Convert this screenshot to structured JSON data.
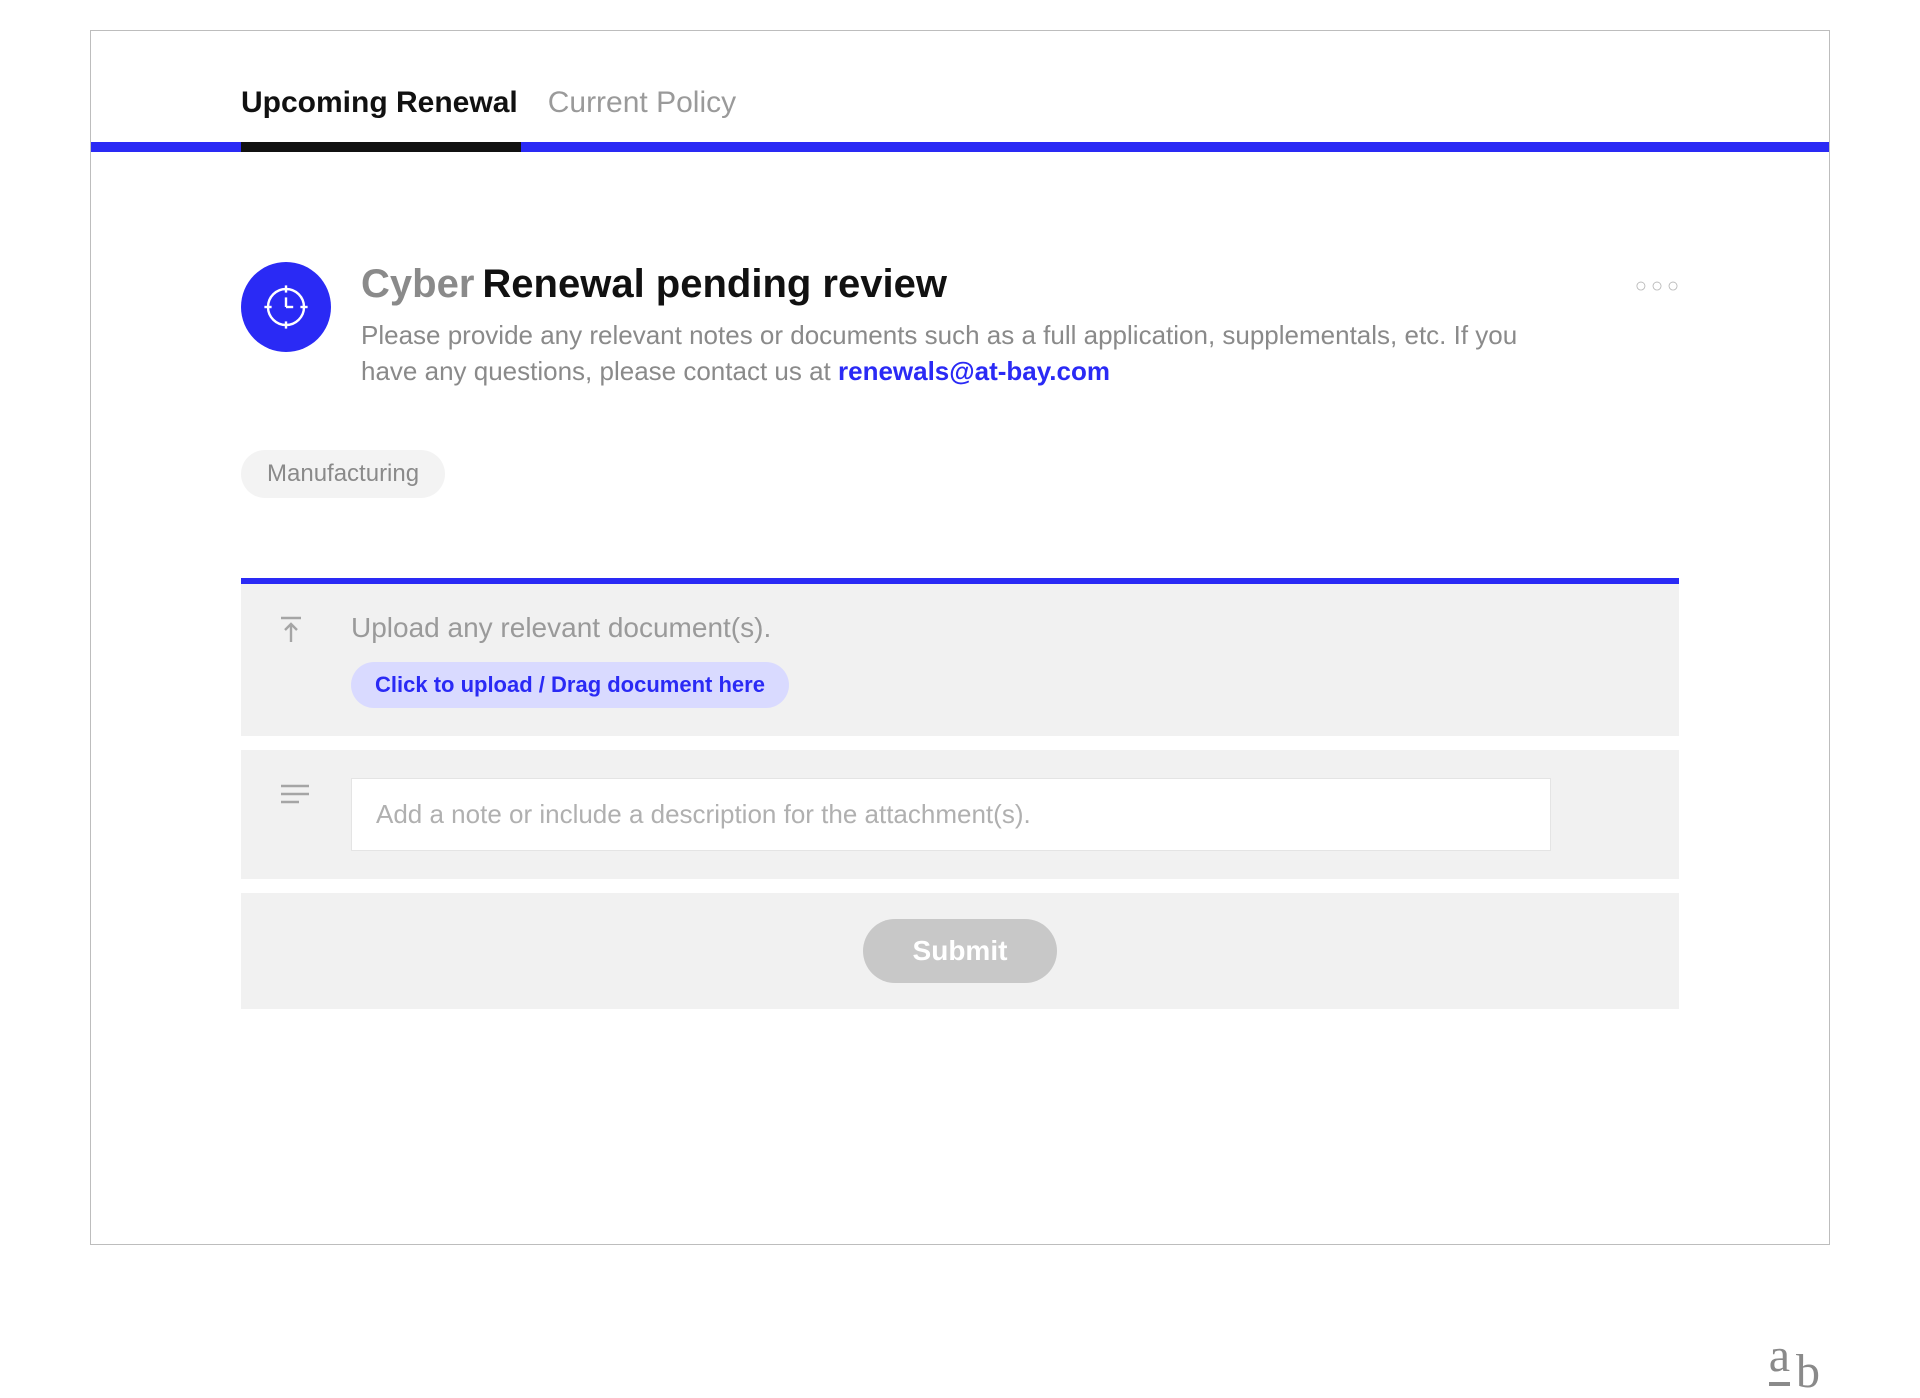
{
  "tabs": {
    "upcoming": "Upcoming Renewal",
    "current": "Current Policy"
  },
  "header": {
    "title_prefix": "Cyber",
    "title_rest": "Renewal pending review",
    "description_pre": "Please provide any relevant notes or documents such as a full application, supplementals, etc. If you have any questions, please contact us at ",
    "contact_email": "renewals@at-bay.com"
  },
  "chip": "Manufacturing",
  "upload": {
    "label": "Upload any relevant document(s).",
    "button": "Click to upload / Drag document here"
  },
  "note": {
    "placeholder": "Add a note or include a description for the attachment(s)."
  },
  "submit_label": "Submit",
  "watermark": {
    "a": "a",
    "b": "b"
  }
}
